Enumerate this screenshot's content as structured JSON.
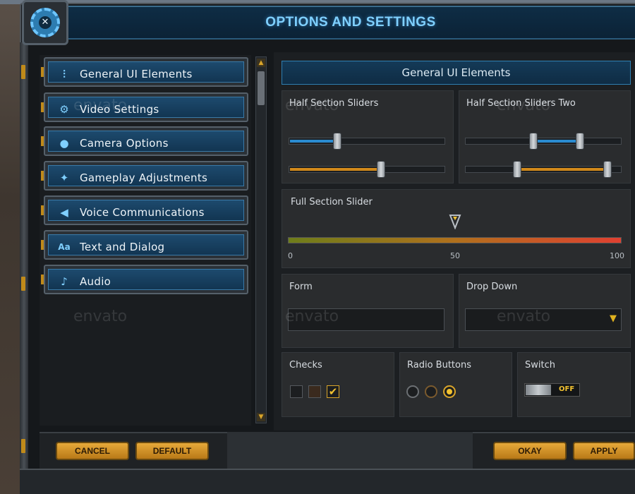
{
  "header": {
    "title": "OPTIONS AND SETTINGS",
    "logo_icon": "tools-gear-icon"
  },
  "nav": {
    "items": [
      {
        "label": "General UI Elements",
        "icon": "sliders-icon",
        "glyph": "⫶"
      },
      {
        "label": "Video Settings",
        "icon": "gear-icon",
        "glyph": "⚙"
      },
      {
        "label": "Camera Options",
        "icon": "camera-icon",
        "glyph": "●"
      },
      {
        "label": "Gameplay Adjustments",
        "icon": "gameplay-icon",
        "glyph": "✦"
      },
      {
        "label": "Voice Communications",
        "icon": "megaphone-icon",
        "glyph": "◀"
      },
      {
        "label": "Text and Dialog",
        "icon": "text-icon",
        "glyph": "Aa"
      },
      {
        "label": "Audio",
        "icon": "music-note-icon",
        "glyph": "♪"
      }
    ]
  },
  "section": {
    "title": "General UI Elements"
  },
  "sliders": {
    "half_one": {
      "label": "Half Section Sliders",
      "blue_value": 0.31,
      "orange_value": 0.59
    },
    "half_two": {
      "label": "Half Section Sliders Two",
      "blue_range": [
        0.43,
        0.73
      ],
      "orange_range": [
        0.33,
        0.91
      ]
    },
    "full": {
      "label": "Full Section Slider",
      "min": "0",
      "mid": "50",
      "max": "100",
      "value": 50
    }
  },
  "form": {
    "label": "Form",
    "value": ""
  },
  "dropdown": {
    "label": "Drop Down",
    "value": ""
  },
  "checks": {
    "label": "Checks",
    "states": [
      false,
      false,
      true
    ]
  },
  "radios": {
    "label": "Radio Buttons",
    "selected": 2
  },
  "switch": {
    "label": "Switch",
    "state": "OFF"
  },
  "watermark": "envato",
  "buttons": {
    "cancel": "CANCEL",
    "default": "DEFAULT",
    "okay": "OKAY",
    "apply": "APPLY"
  },
  "colors": {
    "accent_blue": "#2a8bd0",
    "accent_orange": "#d0881a",
    "gold": "#f2c230",
    "title_blue": "#7fd0ff"
  }
}
